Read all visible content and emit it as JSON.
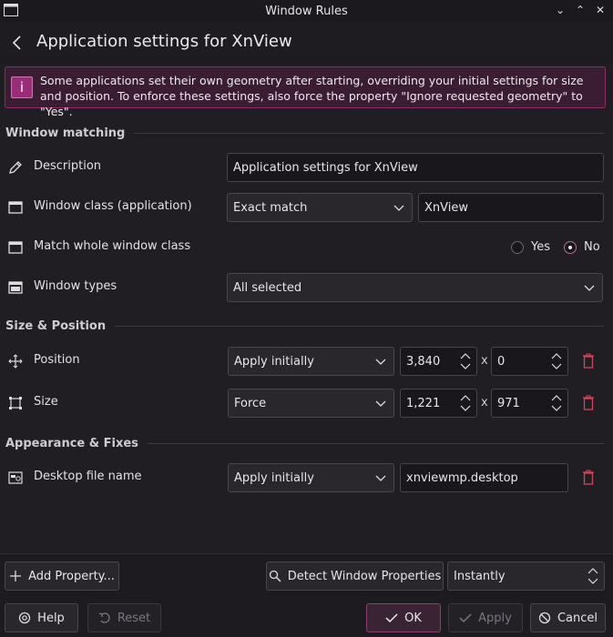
{
  "window": {
    "title": "Window Rules"
  },
  "header": {
    "title": "Application settings for XnView"
  },
  "warning": {
    "text": "Some applications set their own geometry after starting, overriding your initial settings for size and position. To enforce these settings, also force the property \"Ignore requested geometry\" to \"Yes\"."
  },
  "sections": {
    "matching": "Window matching",
    "size_position": "Size & Position",
    "appearance": "Appearance & Fixes"
  },
  "rows": {
    "description": {
      "label": "Description",
      "value": "Application settings for XnView"
    },
    "window_class": {
      "label": "Window class (application)",
      "match": "Exact match",
      "value": "XnView"
    },
    "whole_class": {
      "label": "Match whole window class",
      "yes": "Yes",
      "no": "No",
      "selected": "No"
    },
    "window_types": {
      "label": "Window types",
      "value": "All selected"
    },
    "position": {
      "label": "Position",
      "policy": "Apply initially",
      "x": "3,840",
      "y": "0",
      "sep": "x"
    },
    "size": {
      "label": "Size",
      "policy": "Force",
      "w": "1,221",
      "h": "971",
      "sep": "x"
    },
    "desktop_file": {
      "label": "Desktop file name",
      "policy": "Apply initially",
      "value": "xnviewmp.desktop"
    }
  },
  "bottom": {
    "add_property": "Add Property...",
    "detect": "Detect Window Properties",
    "detect_delay": "Instantly",
    "help": "Help",
    "reset": "Reset",
    "ok": "OK",
    "apply": "Apply",
    "cancel": "Cancel"
  },
  "colors": {
    "accent": "#9b2c77",
    "delete": "#d0475e",
    "background": "#201d23"
  }
}
